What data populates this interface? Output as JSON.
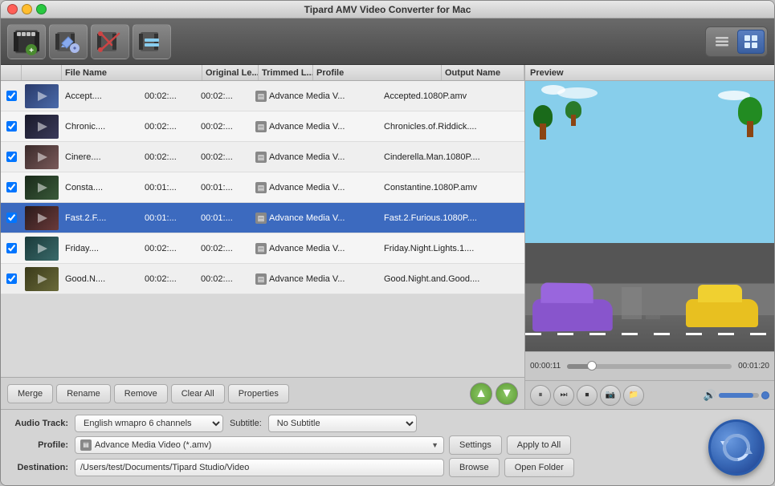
{
  "window": {
    "title": "Tipard AMV Video Converter for Mac"
  },
  "toolbar": {
    "add_btn": "➕",
    "edit_btn": "✏️",
    "cut_btn": "✂️",
    "merge_btn": "📋",
    "view_list_btn": "☰",
    "view_grid_btn": "▦"
  },
  "table": {
    "headers": [
      "File Name",
      "Original Le...",
      "Trimmed L...",
      "Profile",
      "Output Name"
    ],
    "rows": [
      {
        "checked": true,
        "thumb_class": "thumb-1",
        "filename": "Accept....",
        "original": "00:02:...",
        "trimmed": "00:02:...",
        "profile": "Advance Media V...",
        "output": "Accepted.1080P.amv"
      },
      {
        "checked": true,
        "thumb_class": "thumb-2",
        "filename": "Chronic....",
        "original": "00:02:...",
        "trimmed": "00:02:...",
        "profile": "Advance Media V...",
        "output": "Chronicles.of.Riddick...."
      },
      {
        "checked": true,
        "thumb_class": "thumb-3",
        "filename": "Cinere....",
        "original": "00:02:...",
        "trimmed": "00:02:...",
        "profile": "Advance Media V...",
        "output": "Cinderella.Man.1080P...."
      },
      {
        "checked": true,
        "thumb_class": "thumb-4",
        "filename": "Consta....",
        "original": "00:01:...",
        "trimmed": "00:01:...",
        "profile": "Advance Media V...",
        "output": "Constantine.1080P.amv"
      },
      {
        "checked": true,
        "thumb_class": "thumb-5",
        "filename": "Fast.2.F....",
        "original": "00:01:...",
        "trimmed": "00:01:...",
        "profile": "Advance Media V...",
        "output": "Fast.2.Furious.1080P....",
        "selected": true
      },
      {
        "checked": true,
        "thumb_class": "thumb-6",
        "filename": "Friday....",
        "original": "00:02:...",
        "trimmed": "00:02:...",
        "profile": "Advance Media V...",
        "output": "Friday.Night.Lights.1...."
      },
      {
        "checked": true,
        "thumb_class": "thumb-7",
        "filename": "Good.N....",
        "original": "00:02:...",
        "trimmed": "00:02:...",
        "profile": "Advance Media V...",
        "output": "Good.Night.and.Good...."
      }
    ]
  },
  "action_bar": {
    "merge": "Merge",
    "rename": "Rename",
    "remove": "Remove",
    "clear_all": "Clear All",
    "properties": "Properties"
  },
  "preview": {
    "header": "Preview",
    "time_current": "00:00:11",
    "time_total": "00:01:20"
  },
  "controls": {
    "pause_btn": "⏸",
    "forward_btn": "⏭",
    "stop_btn": "⏹",
    "screenshot_btn": "📷",
    "folder_btn": "📁",
    "volume_icon": "🔊"
  },
  "bottom": {
    "audio_track_label": "Audio Track:",
    "audio_track_value": "English wmapro 6 channels",
    "subtitle_label": "Subtitle:",
    "subtitle_value": "No Subtitle",
    "profile_label": "Profile:",
    "profile_value": "Advance Media Video (*.amv)",
    "destination_label": "Destination:",
    "destination_value": "/Users/test/Documents/Tipard Studio/Video",
    "settings_btn": "Settings",
    "apply_to_all_btn": "Apply to All",
    "browse_btn": "Browse",
    "open_folder_btn": "Open Folder"
  }
}
